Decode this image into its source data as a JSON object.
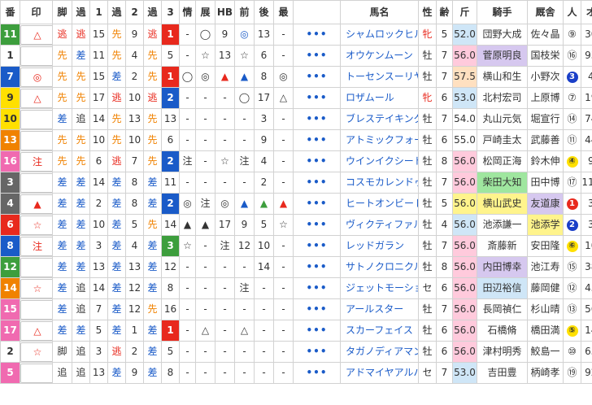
{
  "headers": [
    "番",
    "印",
    "脚",
    "過",
    "1",
    "過",
    "2",
    "過",
    "3",
    "情",
    "展",
    "HB",
    "前",
    "後",
    "最",
    "",
    "馬名",
    "性",
    "齢",
    "斤",
    "騎手",
    "厩舎",
    "人",
    "オッ"
  ],
  "rows": [
    {
      "ban": "11",
      "banColor": "#3d9e3d",
      "mark": "△",
      "markColor": "#e8291d",
      "k": "逃",
      "k1": "逃",
      "c1": "15",
      "s1": "先",
      "c2": "9",
      "s2": "逃",
      "c3": "1",
      "c3bg": "bg-red",
      "jo": "-",
      "ten": "◯",
      "hb": "9",
      "mae": "◎",
      "ato": "13",
      "sai": "-",
      "name": "シャムロックヒル",
      "sex": "牝",
      "age": "5",
      "kin": "52.0",
      "kinBg": "hl-ltblue",
      "jockey": "団野大成",
      "jBg": "",
      "stable": "佐々晶",
      "sBg": "",
      "ninki": "⑨",
      "nType": "pc-o",
      "odds": "30.7"
    },
    {
      "ban": "1",
      "banColor": "#ffffff",
      "mark": "",
      "markColor": "",
      "k": "先",
      "k1": "差",
      "c1": "11",
      "s1": "先",
      "c2": "4",
      "s2": "先",
      "c3": "5",
      "c3bg": "",
      "jo": "-",
      "ten": "☆",
      "hb": "13",
      "mae": "☆",
      "ato": "6",
      "sai": "-",
      "name": "オウケンムーン",
      "sex": "牡",
      "age": "7",
      "kin": "56.0",
      "kinBg": "hl-pink",
      "jockey": "菅原明良",
      "jBg": "hl-lav",
      "stable": "国枝栄",
      "sBg": "",
      "ninki": "⑯",
      "nType": "pc-o",
      "odds": "93.4"
    },
    {
      "ban": "7",
      "banColor": "#1a5bc8",
      "mark": "◎",
      "markColor": "#e8291d",
      "k": "先",
      "k1": "先",
      "c1": "15",
      "s1": "差",
      "c2": "2",
      "s2": "先",
      "c3": "1",
      "c3bg": "bg-red",
      "jo": "◯",
      "ten": "◎",
      "hb": "▲",
      "mae": "▲",
      "ato": "8",
      "sai": "◎",
      "name": "トーセンスーリヤ",
      "sex": "牡",
      "age": "7",
      "kin": "57.5",
      "kinBg": "hl-peach",
      "jockey": "横山和生",
      "jBg": "",
      "stable": "小野次",
      "sBg": "",
      "ninki": "3",
      "nType": "pc-navy",
      "odds": "4.8"
    },
    {
      "ban": "9",
      "banColor": "#ffe000",
      "mark": "△",
      "markColor": "#e8291d",
      "k": "先",
      "k1": "先",
      "c1": "17",
      "s1": "逃",
      "c2": "10",
      "s2": "逃",
      "c3": "2",
      "c3bg": "bg-blue",
      "jo": "-",
      "ten": "-",
      "hb": "-",
      "mae": "◯",
      "ato": "17",
      "sai": "△",
      "name": "ロザムール",
      "sex": "牝",
      "age": "6",
      "kin": "53.0",
      "kinBg": "hl-ltblue",
      "jockey": "北村宏司",
      "jBg": "",
      "stable": "上原博",
      "sBg": "",
      "ninki": "⑦",
      "nType": "pc-o",
      "odds": "19.9"
    },
    {
      "ban": "10",
      "banColor": "#ffe000",
      "mark": "",
      "markColor": "",
      "k": "差",
      "k1": "追",
      "c1": "14",
      "s1": "先",
      "c2": "13",
      "s2": "先",
      "c3": "13",
      "c3bg": "",
      "jo": "-",
      "ten": "-",
      "hb": "-",
      "mae": "-",
      "ato": "3",
      "sai": "-",
      "name": "ブレステイキング",
      "sex": "牡",
      "age": "7",
      "kin": "54.0",
      "kinBg": "",
      "jockey": "丸山元気",
      "jBg": "",
      "stable": "堀宣行",
      "sBg": "",
      "ninki": "⑭",
      "nType": "pc-o",
      "odds": "74.4"
    },
    {
      "ban": "13",
      "banColor": "#f08200",
      "mark": "",
      "markColor": "",
      "k": "先",
      "k1": "先",
      "c1": "10",
      "s1": "先",
      "c2": "10",
      "s2": "先",
      "c3": "6",
      "c3bg": "",
      "jo": "-",
      "ten": "-",
      "hb": "-",
      "mae": "-",
      "ato": "9",
      "sai": "-",
      "name": "アトミックフォース",
      "sex": "牡",
      "age": "6",
      "kin": "55.0",
      "kinBg": "",
      "jockey": "戸崎圭太",
      "jBg": "",
      "stable": "武藤善",
      "sBg": "",
      "ninki": "⑪",
      "nType": "pc-o",
      "odds": "44.6"
    },
    {
      "ban": "16",
      "banColor": "#f06ab0",
      "mark": "注",
      "markColor": "#e8291d",
      "k": "先",
      "k1": "先",
      "c1": "6",
      "s1": "逃",
      "c2": "7",
      "s2": "先",
      "c3": "2",
      "c3bg": "bg-blue",
      "jo": "注",
      "ten": "-",
      "hb": "☆",
      "mae": "注",
      "ato": "4",
      "sai": "-",
      "name": "ウインイクシード",
      "sex": "牡",
      "age": "8",
      "kin": "56.0",
      "kinBg": "hl-pink",
      "jockey": "松岡正海",
      "jBg": "",
      "stable": "鈴木伸",
      "sBg": "",
      "ninki": "④",
      "nType": "pc-y",
      "odds": "9.1"
    },
    {
      "ban": "3",
      "banColor": "#666666",
      "mark": "",
      "markColor": "",
      "k": "差",
      "k1": "差",
      "c1": "14",
      "s1": "差",
      "c2": "8",
      "s2": "差",
      "c3": "11",
      "c3bg": "",
      "jo": "-",
      "ten": "-",
      "hb": "-",
      "mae": "-",
      "ato": "2",
      "sai": "-",
      "name": "コスモカレンドゥラ",
      "sex": "牡",
      "age": "7",
      "kin": "56.0",
      "kinBg": "hl-pink",
      "jockey": "柴田大知",
      "jBg": "hl-green",
      "stable": "田中博",
      "sBg": "",
      "ninki": "⑰",
      "nType": "pc-o",
      "odds": "114.6"
    },
    {
      "ban": "4",
      "banColor": "#666666",
      "mark": "▲",
      "markColor": "#e8291d",
      "k": "差",
      "k1": "差",
      "c1": "2",
      "s1": "差",
      "c2": "8",
      "s2": "差",
      "c3": "2",
      "c3bg": "bg-blue",
      "jo": "◎",
      "ten": "注",
      "hb": "◎",
      "mae": "▲",
      "ato": "▲",
      "sai": "▲",
      "name": "ヒートオンビート",
      "sex": "牡",
      "age": "5",
      "kin": "56.0",
      "kinBg": "hl-yellow",
      "jockey": "横山武史",
      "jBg": "hl-yellow",
      "stable": "友道康",
      "sBg": "hl-lav",
      "ninki": "1",
      "nType": "pc-red",
      "odds": "3.1"
    },
    {
      "ban": "6",
      "banColor": "#e8291d",
      "mark": "☆",
      "markColor": "#e8291d",
      "k": "差",
      "k1": "差",
      "c1": "10",
      "s1": "差",
      "c2": "5",
      "s2": "先",
      "c3": "14",
      "c3bg": "",
      "jo": "▲",
      "ten": "▲",
      "hb": "17",
      "mae": "9",
      "ato": "5",
      "sai": "☆",
      "name": "ヴィクティファルス",
      "sex": "牡",
      "age": "4",
      "kin": "56.0",
      "kinBg": "hl-ltblue",
      "jockey": "池添謙一",
      "jBg": "",
      "stable": "池添学",
      "sBg": "hl-yellow",
      "ninki": "2",
      "nType": "pc-blue",
      "odds": "3.9"
    },
    {
      "ban": "8",
      "banColor": "#1a5bc8",
      "mark": "注",
      "markColor": "#e8291d",
      "k": "差",
      "k1": "差",
      "c1": "3",
      "s1": "差",
      "c2": "4",
      "s2": "差",
      "c3": "3",
      "c3bg": "bg-green",
      "jo": "☆",
      "ten": "-",
      "hb": "注",
      "mae": "12",
      "ato": "10",
      "sai": "-",
      "name": "レッドガラン",
      "sex": "牡",
      "age": "7",
      "kin": "56.0",
      "kinBg": "hl-pink",
      "jockey": "斎藤新",
      "jBg": "",
      "stable": "安田隆",
      "sBg": "",
      "ninki": "⑥",
      "nType": "pc-y",
      "odds": "10.7"
    },
    {
      "ban": "12",
      "banColor": "#3d9e3d",
      "mark": "",
      "markColor": "",
      "k": "差",
      "k1": "差",
      "c1": "13",
      "s1": "差",
      "c2": "13",
      "s2": "差",
      "c3": "12",
      "c3bg": "",
      "jo": "-",
      "ten": "-",
      "hb": "-",
      "mae": "-",
      "ato": "14",
      "sai": "-",
      "name": "サトノクロニクル",
      "sex": "牡",
      "age": "8",
      "kin": "56.0",
      "kinBg": "hl-pink",
      "jockey": "内田博幸",
      "jBg": "hl-lav",
      "stable": "池江寿",
      "sBg": "",
      "ninki": "⑮",
      "nType": "pc-o",
      "odds": "38.1"
    },
    {
      "ban": "14",
      "banColor": "#f08200",
      "mark": "☆",
      "markColor": "#e8291d",
      "k": "差",
      "k1": "追",
      "c1": "14",
      "s1": "差",
      "c2": "12",
      "s2": "差",
      "c3": "8",
      "c3bg": "",
      "jo": "-",
      "ten": "-",
      "hb": "-",
      "mae": "注",
      "ato": "-",
      "sai": "-",
      "name": "ジェットモーション",
      "sex": "セ",
      "age": "6",
      "kin": "56.0",
      "kinBg": "hl-pink",
      "jockey": "田辺裕信",
      "jBg": "hl-ltblue",
      "stable": "藤岡健",
      "sBg": "",
      "ninki": "⑫",
      "nType": "pc-o",
      "odds": "45.9"
    },
    {
      "ban": "15",
      "banColor": "#f06ab0",
      "mark": "",
      "markColor": "",
      "k": "差",
      "k1": "追",
      "c1": "7",
      "s1": "差",
      "c2": "12",
      "s2": "先",
      "c3": "16",
      "c3bg": "",
      "jo": "-",
      "ten": "-",
      "hb": "-",
      "mae": "-",
      "ato": "-",
      "sai": "-",
      "name": "アールスター",
      "sex": "牡",
      "age": "7",
      "kin": "56.0",
      "kinBg": "hl-pink",
      "jockey": "長岡禎仁",
      "jBg": "",
      "stable": "杉山晴",
      "sBg": "",
      "ninki": "⑬",
      "nType": "pc-o",
      "odds": "56.3"
    },
    {
      "ban": "17",
      "banColor": "#f06ab0",
      "mark": "△",
      "markColor": "#e8291d",
      "k": "差",
      "k1": "差",
      "c1": "5",
      "s1": "差",
      "c2": "1",
      "s2": "差",
      "c3": "1",
      "c3bg": "bg-red",
      "jo": "-",
      "ten": "△",
      "hb": "-",
      "mae": "△",
      "ato": "-",
      "sai": "-",
      "name": "スカーフェイス",
      "sex": "牡",
      "age": "6",
      "kin": "56.0",
      "kinBg": "hl-pink",
      "jockey": "石橋脩",
      "jBg": "",
      "stable": "橋田満",
      "sBg": "",
      "ninki": "⑤",
      "nType": "pc-y",
      "odds": "14.4"
    },
    {
      "ban": "2",
      "banColor": "#ffffff",
      "mark": "☆",
      "markColor": "#e8291d",
      "k": "脚",
      "k1": "追",
      "c1": "3",
      "s1": "逃",
      "c2": "2",
      "s2": "差",
      "c3": "5",
      "c3bg": "",
      "jo": "-",
      "ten": "-",
      "hb": "-",
      "mae": "-",
      "ato": "-",
      "sai": "-",
      "name": "タガノディアマンテ",
      "sex": "牡",
      "age": "6",
      "kin": "56.0",
      "kinBg": "hl-pink",
      "jockey": "津村明秀",
      "jBg": "",
      "stable": "鮫島一",
      "sBg": "",
      "ninki": "⑩",
      "nType": "pc-o",
      "odds": "65.2"
    },
    {
      "ban": "5",
      "banColor": "#f06ab0",
      "mark": "",
      "markColor": "",
      "k": "追",
      "k1": "追",
      "c1": "13",
      "s1": "差",
      "c2": "9",
      "s2": "差",
      "c3": "8",
      "c3bg": "",
      "jo": "-",
      "ten": "-",
      "hb": "-",
      "mae": "-",
      "ato": "-",
      "sai": "-",
      "name": "アドマイヤアルバ",
      "sex": "セ",
      "age": "7",
      "kin": "53.0",
      "kinBg": "hl-ltblue",
      "jockey": "吉田豊",
      "jBg": "",
      "stable": "柄崎孝",
      "sBg": "",
      "ninki": "⑲",
      "nType": "pc-o",
      "odds": "92.5"
    }
  ]
}
